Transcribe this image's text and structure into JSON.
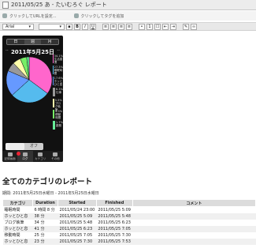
{
  "window": {
    "title": "2011/05/25 あ - たいむろぐ レポート"
  },
  "linkbar": {
    "items": [
      {
        "label": "クリックしてURLを設定..."
      },
      {
        "label": "クリックしてタグを追加"
      }
    ]
  },
  "toolbar": {
    "font": "Arial",
    "size": "",
    "bold": "B",
    "italic": "I",
    "underline": "U"
  },
  "phone": {
    "segments": [
      "日",
      "週",
      "月"
    ],
    "date": "2011年5月25日",
    "legend": [
      {
        "pct": "34.1%",
        "name": "生活習慣",
        "color": "#ff66cc"
      },
      {
        "pct": "27.3%",
        "name": "睡眠時間",
        "color": "#55bbee"
      },
      {
        "pct": "17.6%",
        "name": "ホッとひと息",
        "color": "#6699ff"
      },
      {
        "pct": "6.3%",
        "name": "仕事",
        "color": "#999999"
      },
      {
        "pct": "5.5%",
        "name": "ブログ執筆",
        "color": "#ffffaa"
      },
      {
        "pct": "4.5%",
        "name": "移動時間",
        "color": "#77ee66"
      },
      {
        "pct": "1.7%",
        "name": "雑務",
        "color": "#66ee99"
      }
    ],
    "toggle": {
      "left": "",
      "right": "オフ"
    },
    "note": "非ログ時間の表示",
    "tabs": [
      "記録画面",
      "ログ",
      "カテゴリ",
      "その他"
    ]
  },
  "report": {
    "title": "全てのカテゴリのレポート",
    "period": "期間: 2011年5月25日水曜日 - 2011年5月25日水曜日",
    "columns": [
      "カテゴリ",
      "Duration",
      "Started",
      "Finished",
      "コメント"
    ],
    "rows": [
      [
        "睡眠時間",
        "6 時間 8 分",
        "2011/05/24 23:00",
        "2011/05/25 5:09",
        ""
      ],
      [
        "ホッとひと息",
        "38 分",
        "2011/05/25 5:09",
        "2011/05/25 5:48",
        ""
      ],
      [
        "ブログ執筆",
        "34 分",
        "2011/05/25 5:48",
        "2011/05/25 6:23",
        ""
      ],
      [
        "ホッとひと息",
        "41 分",
        "2011/05/25 6:23",
        "2011/05/25 7:05",
        ""
      ],
      [
        "移動時間",
        "25 分",
        "2011/05/25 7:05",
        "2011/05/25 7:30",
        ""
      ],
      [
        "ホッとひと息",
        "23 分",
        "2011/05/25 7:30",
        "2011/05/25 7:53",
        ""
      ]
    ]
  }
}
